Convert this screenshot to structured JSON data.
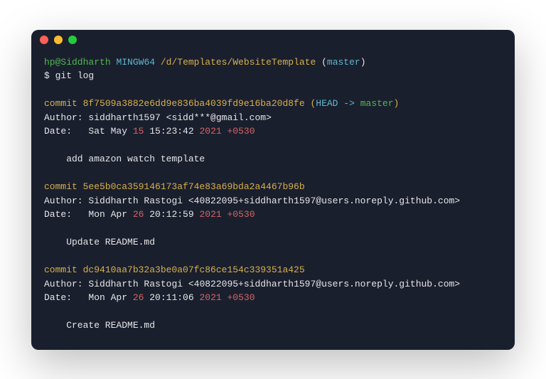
{
  "prompt": {
    "user_host": "hp@Siddharth",
    "env": "MINGW64",
    "path": "/d/Templates/WebsiteTemplate",
    "branch": "master",
    "symbol": "$",
    "command": "git log"
  },
  "commits": [
    {
      "hash": "8f7509a3882e6dd9e836ba4039fd9e16ba20d8fe",
      "refs_open": " (",
      "refs_head": "HEAD -> ",
      "refs_branch": "master",
      "refs_close": ")",
      "author": "siddharth1597 <sidd***@gmail.com>",
      "date_prefix": "Date:   ",
      "date_day": "Sat May ",
      "date_dom": "15",
      "date_time": " 15:23:42 ",
      "date_year": "2021",
      "date_tz": " +0530",
      "message": "add amazon watch template"
    },
    {
      "hash": "5ee5b0ca359146173af74e83a69bda2a4467b96b",
      "refs_open": "",
      "refs_head": "",
      "refs_branch": "",
      "refs_close": "",
      "author": "Siddharth Rastogi <40822095+siddharth1597@users.noreply.github.com>",
      "date_prefix": "Date:   ",
      "date_day": "Mon Apr ",
      "date_dom": "26",
      "date_time": " 20:12:59 ",
      "date_year": "2021",
      "date_tz": " +0530",
      "message": "Update README.md"
    },
    {
      "hash": "dc9410aa7b32a3be0a07fc86ce154c339351a425",
      "refs_open": "",
      "refs_head": "",
      "refs_branch": "",
      "refs_close": "",
      "author": "Siddharth Rastogi <40822095+siddharth1597@users.noreply.github.com>",
      "date_prefix": "Date:   ",
      "date_day": "Mon Apr ",
      "date_dom": "26",
      "date_time": " 20:11:06 ",
      "date_year": "2021",
      "date_tz": " +0530",
      "message": "Create README.md"
    }
  ],
  "labels": {
    "commit": "commit ",
    "author": "Author: "
  }
}
